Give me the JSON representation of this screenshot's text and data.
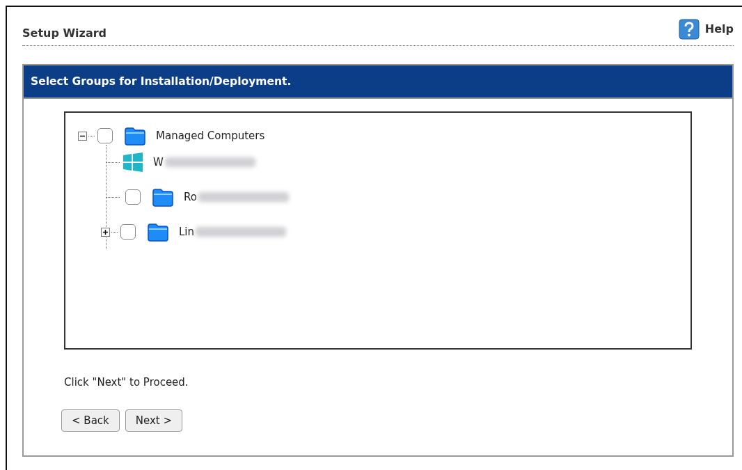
{
  "header": {
    "title": "Setup Wizard",
    "help": "Help"
  },
  "panel": {
    "title": "Select Groups for Installation/Deployment."
  },
  "tree": [
    {
      "kind": "folder",
      "label": "Managed Computers",
      "checked": false,
      "expanded": true,
      "children": [
        {
          "kind": "computer",
          "label": "W",
          "blurred": true
        },
        {
          "kind": "folder",
          "label": "Ro",
          "checked": false,
          "blurred": true
        },
        {
          "kind": "folder",
          "label": "Lin",
          "checked": false,
          "expanded": false,
          "blurred": true
        }
      ]
    }
  ],
  "hint": "Click \"Next\" to Proceed.",
  "buttons": [
    "< Back",
    "Next >"
  ]
}
